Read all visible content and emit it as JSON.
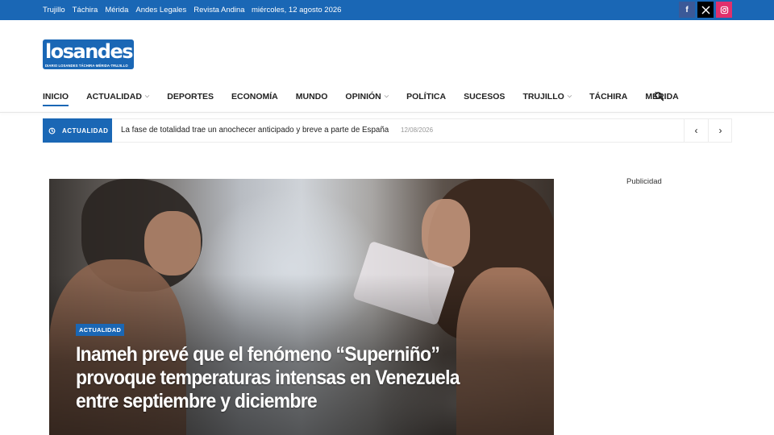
{
  "topbar": {
    "links": [
      "Trujillo",
      "Táchira",
      "Mérida",
      "Andes Legales",
      "Revista Andina"
    ],
    "date": "miércoles, 12 agosto 2026",
    "social": [
      {
        "icon": "facebook-icon",
        "glyph": "f",
        "color": "#3b5998"
      },
      {
        "icon": "x-icon",
        "glyph": "𝕏",
        "color": "#000000"
      },
      {
        "icon": "instagram-icon",
        "glyph": "◎",
        "color": "#e1306c"
      }
    ]
  },
  "logo": {
    "word": "losandes",
    "tagline": "DIARIO LOSANDES TÁCHIRA·MÉRIDA·TRUJILLO"
  },
  "nav": {
    "items": [
      {
        "label": "INICIO",
        "active": true,
        "dropdown": false
      },
      {
        "label": "ACTUALIDAD",
        "active": false,
        "dropdown": true
      },
      {
        "label": "DEPORTES",
        "active": false,
        "dropdown": false
      },
      {
        "label": "ECONOMÍA",
        "active": false,
        "dropdown": false
      },
      {
        "label": "MUNDO",
        "active": false,
        "dropdown": false
      },
      {
        "label": "OPINIÓN",
        "active": false,
        "dropdown": true
      },
      {
        "label": "POLÍTICA",
        "active": false,
        "dropdown": false
      },
      {
        "label": "SUCESOS",
        "active": false,
        "dropdown": false
      },
      {
        "label": "TRUJILLO",
        "active": false,
        "dropdown": true
      },
      {
        "label": "TÁCHIRA",
        "active": false,
        "dropdown": false
      },
      {
        "label": "MÉRIDA",
        "active": false,
        "dropdown": false
      }
    ],
    "search_icon": "search-icon"
  },
  "ticker": {
    "label": "ACTUALIDAD",
    "headline": "La fase de totalidad trae un anochecer anticipado y breve a parte de España",
    "date": "12/08/2026",
    "prev": "‹",
    "next": "›"
  },
  "hero": {
    "category": "ACTUALIDAD",
    "title": "Inameh prevé que el fenómeno “Superniño” provoque temperaturas intensas en Venezuela entre septiembre y diciembre"
  },
  "sidebar": {
    "ad_label": "Publicidad"
  },
  "colors": {
    "brand": "#1a67b5"
  }
}
